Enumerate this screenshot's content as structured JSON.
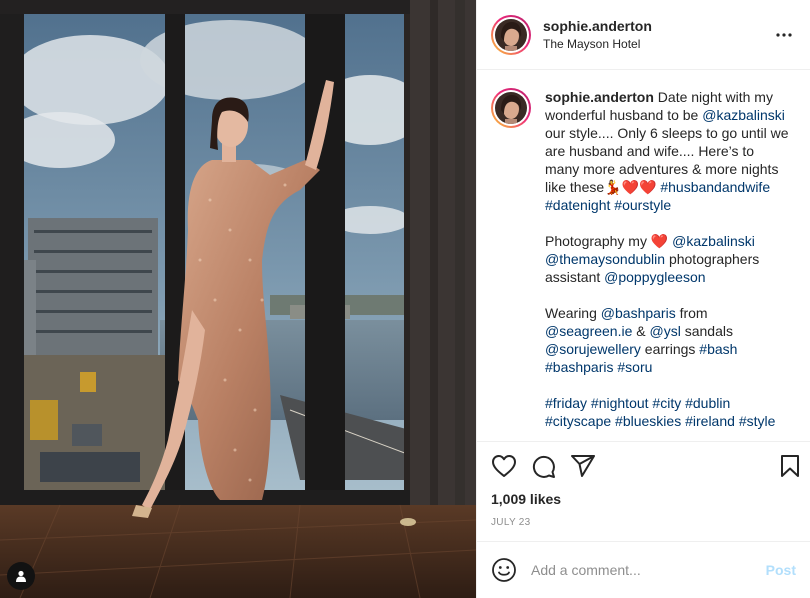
{
  "post": {
    "username": "sophie.anderton",
    "location": "The Mayson Hotel",
    "caption": {
      "username": "sophie.anderton",
      "intro": " Date night with my wonderful husband to be ",
      "mention_1": "@kazbalinski",
      "intro_2": " our style.... Only 6 sleeps to go until we are husband and wife.... Here’s to many more adventures & more nights like these💃❤️❤️ ",
      "hashtags_1": [
        "#husbandandwife",
        "#datenight",
        "#ourstyle"
      ],
      "photo_prefix": "Photography my ",
      "photo_heart": "❤️",
      "photo_mention_1": "@kazbalinski",
      "photo_mention_2": "@themaysondublin",
      "photo_mid": " photographers assistant ",
      "photo_mention_3": "@poppygleeson",
      "wear_prefix": "Wearing ",
      "wear_mention_1": "@bashparis",
      "wear_from": " from ",
      "wear_mention_2": "@seagreen.ie",
      "wear_amp": " & ",
      "wear_mention_3": "@ysl",
      "wear_sandals": " sandals ",
      "wear_mention_4": "@sorujewellery",
      "wear_earrings": " earrings ",
      "wear_hashtags": [
        "#bash",
        "#bashparis",
        "#soru"
      ],
      "hashtags_2": [
        "#friday",
        "#nightout",
        "#city",
        "#dublin",
        "#cityscape",
        "#blueskies",
        "#ireland",
        "#style"
      ]
    },
    "likes": "1,009 likes",
    "date": "JULY 23",
    "comment_placeholder": "Add a comment...",
    "post_label": "Post"
  },
  "colors": {
    "link": "#00376b",
    "post_button": "#b2dffc",
    "muted": "#8e8e8e",
    "border": "#efefef"
  },
  "icons": {
    "more": "more-horizontal-icon",
    "like": "heart-outline-icon",
    "comment": "comment-bubble-icon",
    "share": "paper-plane-icon",
    "save": "bookmark-icon",
    "emoji": "smiley-face-icon",
    "tagged": "user-silhouette-icon"
  }
}
